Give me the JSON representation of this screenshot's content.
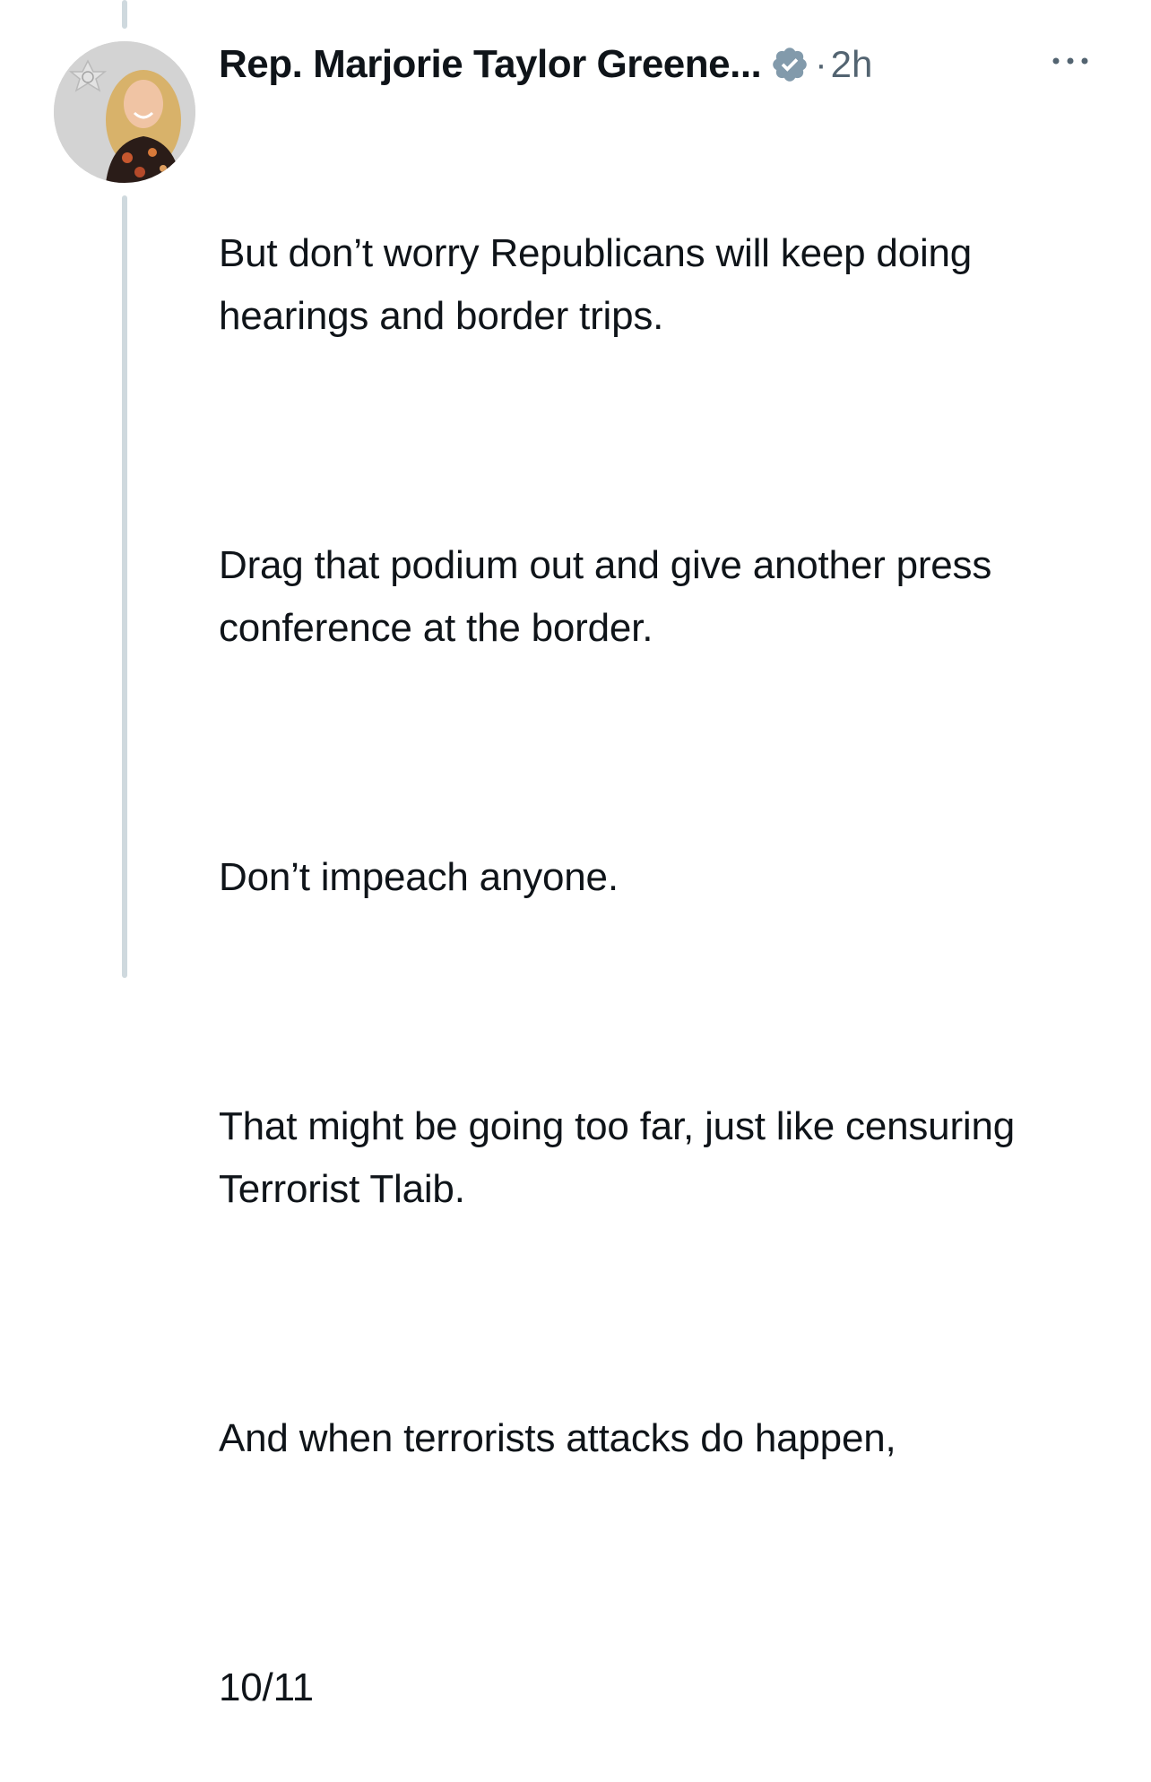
{
  "tweet": {
    "author_name": "Rep. Marjorie Taylor Greene...",
    "verified_icon": "verified-badge-icon",
    "separator": "·",
    "timestamp": "2h",
    "more_icon": "more-options-icon",
    "paragraphs": [
      "But don’t worry Republicans will keep doing hearings and border trips.",
      "Drag that podium out and give another press conference at the border.",
      "Don’t impeach anyone.",
      "That might be going too far, just like censuring Terrorist Tlaib.",
      "And when terrorists attacks do happen,"
    ],
    "thread_counter": "10/11"
  },
  "colors": {
    "thread_line": "#cfd9de",
    "secondary_text": "#536471",
    "badge_fill": "#829aab",
    "text": "#0f1419"
  }
}
